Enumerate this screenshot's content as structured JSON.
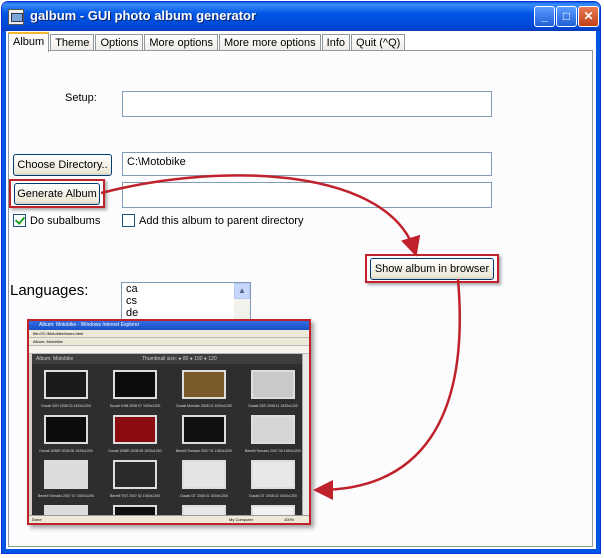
{
  "window": {
    "title": "galbum - GUI photo album generator",
    "minimize": "_",
    "maximize": "□",
    "close": "✕"
  },
  "tabs": [
    {
      "label": "Album"
    },
    {
      "label": "Theme"
    },
    {
      "label": "Options"
    },
    {
      "label": "More options"
    },
    {
      "label": "More more options"
    },
    {
      "label": "Info"
    },
    {
      "label": "Quit  (^Q)"
    }
  ],
  "album": {
    "setup_label": "Setup:",
    "setup_value": "",
    "choose_directory_label": "Choose Directory..",
    "directory_value": "C:\\Motobike",
    "generate_album_label": "Generate Album",
    "generate_output": "",
    "do_subalbums_label": "Do subalbums",
    "do_subalbums_checked": true,
    "add_to_parent_label": "Add this album to parent directory",
    "add_to_parent_checked": false,
    "show_in_browser_label": "Show album in browser",
    "languages_label": "Languages:",
    "languages": [
      "ca",
      "cs",
      "de"
    ]
  },
  "browser_preview": {
    "title": "Album: Motobike - Windows Internet Explorer",
    "address": "file:///C:/Motobike/index.html",
    "tab": "Album: Motobike",
    "page_heading": "Album: Motobike",
    "thumbnail_size": "Thumbnail size: ● 80 ● 100 ● 120",
    "status_left": "Done",
    "status_right": "My Computer",
    "zoom": "100%",
    "captions": [
      "Ducati S2R 2008 03 1920x1200",
      "Ducati 1098 2008 07 1920x1200",
      "Ducati Monster 2008 01 1920x1200",
      "Ducati S2R 2008 11 1920x1200",
      "Ducati 1098R 2008 06 1920x1200",
      "Ducati 1098R 2008 05 1920x1200",
      "Benelli Tornado 2007 01 1920x1200",
      "Benelli Tornado 2007 05 1920x1200",
      "Benelli Tornado 2007 07 1920x1200",
      "Benelli TNT 2007 02 1920x1200",
      "Ducati GT 2008 01 1920x1200",
      "Ducati GT 2008 02 1920x1200"
    ],
    "thumb_colors": [
      "#1b1b1b",
      "#0c0c0c",
      "#7a5a2a",
      "#c9c9c9",
      "#0d0d0d",
      "#8b0c10",
      "#101010",
      "#d6d6d6",
      "#dcdcdc",
      "#2a2a2a",
      "#e4e4e4",
      "#e8e8e8",
      "#dcdcdc",
      "#101010",
      "#e8e8e8",
      "#f2f2f2"
    ]
  },
  "colors": {
    "annotation": "#c0222b",
    "title_bar": "#0055e5"
  }
}
